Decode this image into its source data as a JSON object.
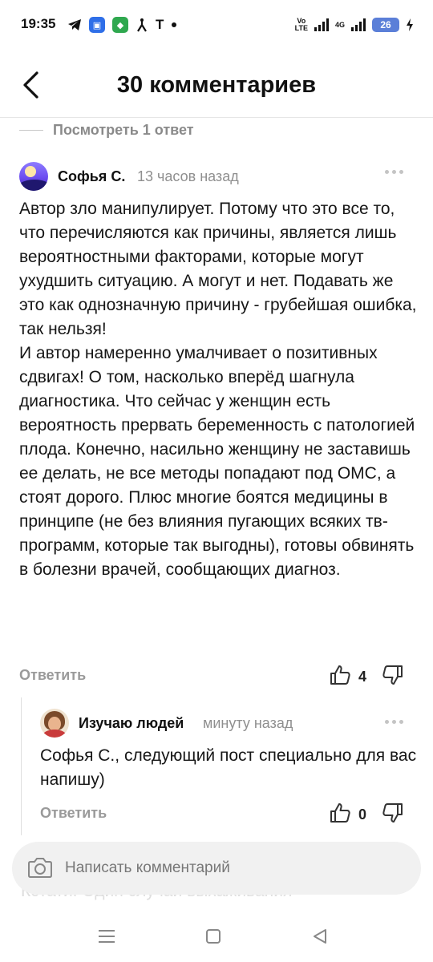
{
  "status_bar": {
    "time": "19:35",
    "icons_left": [
      "telegram-icon",
      "app-icon",
      "app-icon",
      "signal-arrow-icon",
      "t-icon",
      "dot-icon"
    ],
    "network_label": "Vo\nLTE",
    "network_type": "4G",
    "battery": "26"
  },
  "header": {
    "title": "30 комментариев",
    "back_icon": "chevron-left-icon"
  },
  "view_replies": "Посмотреть 1 ответ",
  "comment": {
    "author": "Софья С.",
    "time": "13 часов назад",
    "text": "Автор зло манипулирует. Потому что это все то, что перечисляются как причины, является лишь вероятностными факторами, которые могут ухудшить ситуацию. А могут и нет. Подавать же это как однозначную причину - грубейшая ошибка, так нельзя!\nИ автор намеренно умалчивает о позитивных сдвигах! О том, насколько вперёд шагнула диагностика. Что сейчас у женщин есть вероятность прервать беременность с патологией плода. Конечно, насильно женщину не заставишь ее делать, не все методы попадают под ОМС, а стоят дорого. Плюс многие боятся медицины в принципе (не без влияния пугающих всяких тв-программ, которые так выгодны), готовы обвинять в болезни врачей, сообщающих диагноз.",
    "reply_label": "Ответить",
    "likes": "4"
  },
  "reply": {
    "author": "Изучаю людей",
    "time": "минуту назад",
    "text": "Софья С., следующий пост специально для вас напишу)",
    "reply_label": "Ответить",
    "likes": "0"
  },
  "peek_text": "Кстати. Один случай выхаживания",
  "composer": {
    "placeholder": "Написать комментарий",
    "icon": "camera-icon"
  },
  "nav": {
    "items": [
      "menu-icon",
      "home-square-icon",
      "back-triangle-icon"
    ]
  }
}
